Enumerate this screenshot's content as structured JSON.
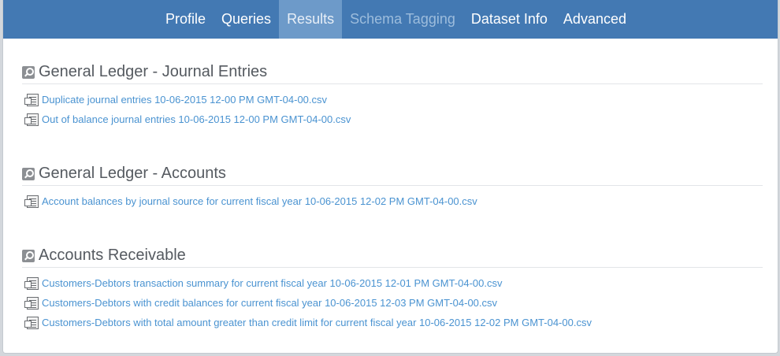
{
  "nav": {
    "items": [
      {
        "label": "Profile"
      },
      {
        "label": "Queries"
      },
      {
        "label": "Results"
      },
      {
        "label": "Schema Tagging"
      },
      {
        "label": "Dataset Info"
      },
      {
        "label": "Advanced"
      }
    ],
    "active": "Results",
    "disabled": "Schema Tagging"
  },
  "sections": [
    {
      "title": "General Ledger - Journal Entries",
      "files": [
        "Duplicate journal entries 10-06-2015 12-00 PM GMT-04-00.csv",
        "Out of balance journal entries 10-06-2015 12-00 PM GMT-04-00.csv"
      ]
    },
    {
      "title": "General Ledger - Accounts",
      "files": [
        "Account balances by journal source for current fiscal year 10-06-2015 12-02 PM GMT-04-00.csv"
      ]
    },
    {
      "title": "Accounts Receivable",
      "files": [
        "Customers-Debtors transaction summary for current fiscal year 10-06-2015 12-01 PM GMT-04-00.csv",
        "Customers-Debtors with credit balances for current fiscal year 10-06-2015 12-03 PM GMT-04-00.csv",
        "Customers-Debtors with total amount greater than credit limit for current fiscal year 10-06-2015 12-02 PM GMT-04-00.csv"
      ]
    }
  ],
  "colors": {
    "navbar": "#4379b3",
    "nav_active": "#6d9ac9",
    "link": "#4a93d1",
    "section_title": "#555a60"
  }
}
